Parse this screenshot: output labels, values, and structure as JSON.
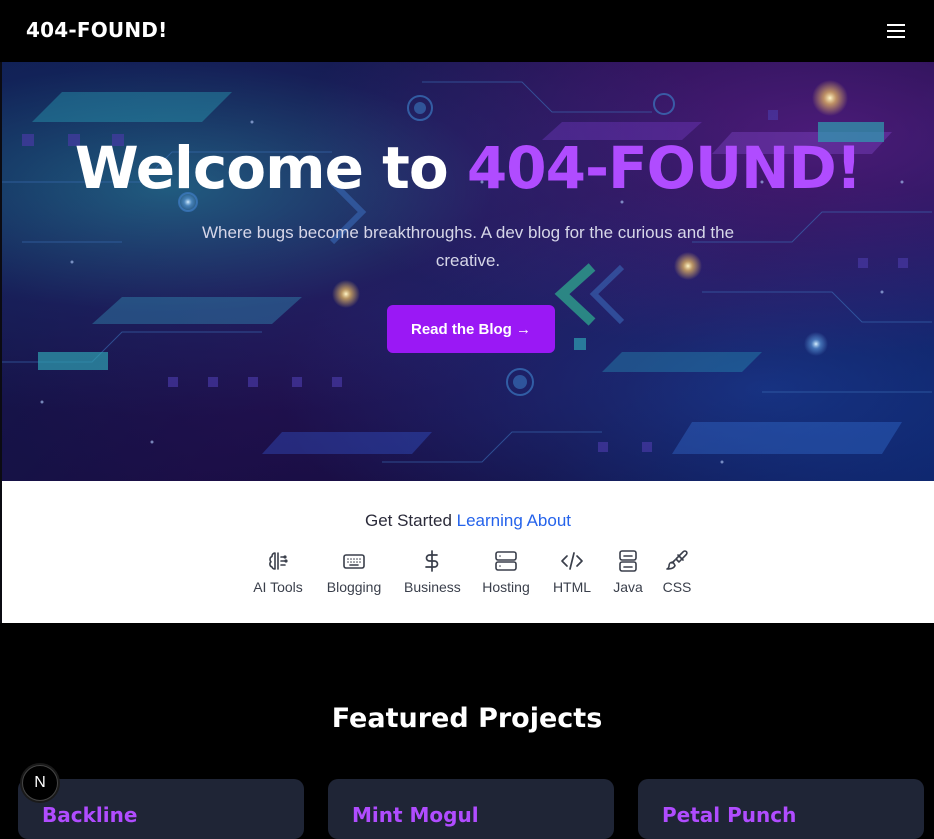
{
  "nav": {
    "brand": "404-FOUND!",
    "menu_icon": "hamburger-menu-icon"
  },
  "hero": {
    "title_prefix": "Welcome to ",
    "title_accent": "404-FOUND!",
    "subtitle": "Where bugs become breakthroughs. A dev blog for the curious and the creative.",
    "cta_label": "Read the Blog →",
    "accent_color": "#b04cff",
    "button_color": "#9a18f5"
  },
  "topics": {
    "heading_prefix": "Get Started ",
    "heading_accent": "Learning About",
    "items": [
      {
        "label": "AI Tools",
        "icon": "brain-icon"
      },
      {
        "label": "Blogging",
        "icon": "keyboard-icon"
      },
      {
        "label": "Business",
        "icon": "dollar-icon"
      },
      {
        "label": "Hosting",
        "icon": "server-icon"
      },
      {
        "label": "HTML",
        "icon": "code-icon"
      },
      {
        "label": "Java",
        "icon": "database-icon"
      },
      {
        "label": "CSS",
        "icon": "paintbrush-icon"
      }
    ]
  },
  "featured": {
    "title": "Featured Projects",
    "cards": [
      {
        "title": "Backline"
      },
      {
        "title": "Mint Mogul"
      },
      {
        "title": "Petal Punch"
      }
    ]
  },
  "badge": {
    "label": "N"
  }
}
